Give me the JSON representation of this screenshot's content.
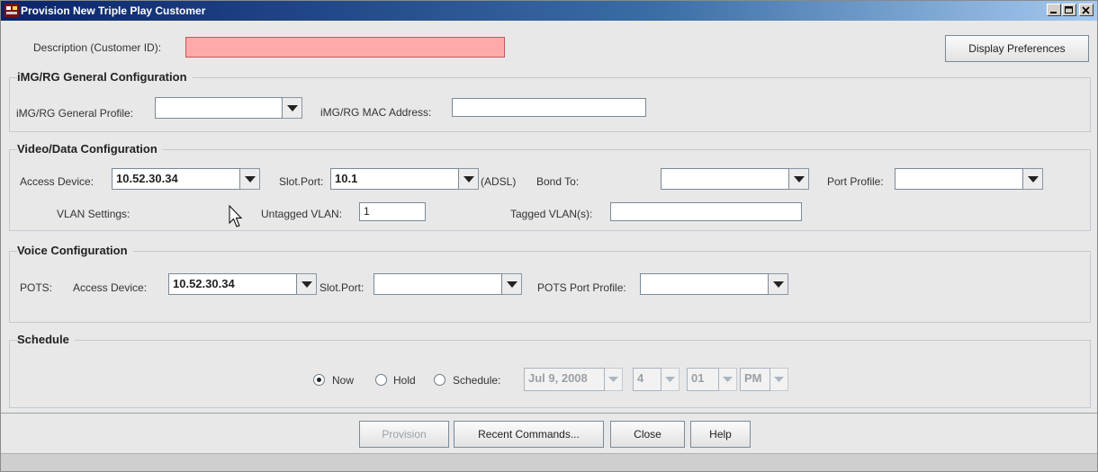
{
  "window": {
    "title": "Provision New Triple Play Customer",
    "controls": [
      "minimize-icon",
      "maximize-icon",
      "close-icon"
    ]
  },
  "header": {
    "description_label": "Description (Customer ID):",
    "description_value": "",
    "display_prefs_label": "Display Preferences",
    "invalid_field_color": "#ffaaaa"
  },
  "img_rg": {
    "title": "iMG/RG General Configuration",
    "profile_label": "iMG/RG General Profile:",
    "profile_value": "",
    "mac_label": "iMG/RG MAC Address:",
    "mac_value": ""
  },
  "video_data": {
    "title": "Video/Data Configuration",
    "access_device_label": "Access Device:",
    "access_device_value": "10.52.30.34",
    "slot_port_label": "Slot.Port:",
    "slot_port_value": "10.1",
    "adsl_label": "(ADSL)",
    "bond_to_label": "Bond To:",
    "bond_to_value": "",
    "port_profile_label": "Port Profile:",
    "port_profile_value": "",
    "vlan_settings_label": "VLAN Settings:",
    "untagged_label": "Untagged VLAN:",
    "untagged_value": "1",
    "tagged_label": "Tagged VLAN(s):",
    "tagged_value": ""
  },
  "voice": {
    "title": "Voice Configuration",
    "pots_label": "POTS:",
    "access_device_label": "Access Device:",
    "access_device_value": "10.52.30.34",
    "slot_port_label": "Slot.Port:",
    "slot_port_value": "",
    "pots_profile_label": "POTS Port Profile:",
    "pots_profile_value": ""
  },
  "schedule": {
    "title": "Schedule",
    "options": [
      "Now",
      "Hold",
      "Schedule:"
    ],
    "selected": "Now",
    "date": "Jul 9, 2008",
    "hour": "4",
    "minute": "01",
    "ampm": "PM"
  },
  "footer": {
    "provision": "Provision",
    "recent": "Recent Commands...",
    "close": "Close",
    "help": "Help"
  }
}
